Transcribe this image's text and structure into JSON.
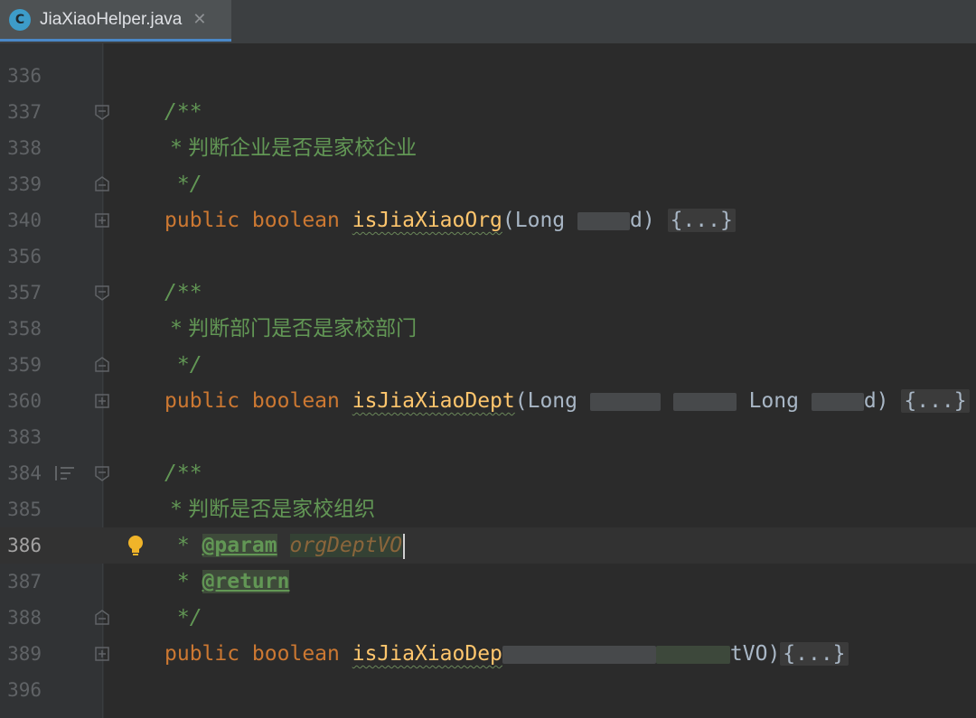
{
  "tab": {
    "icon_letter": "C",
    "filename": "JiaXiaoHelper.java",
    "close": "✕"
  },
  "lines": [
    {
      "n": "336"
    },
    {
      "n": "337",
      "comment": "/**"
    },
    {
      "n": "338",
      "comment": " * 判断企业是否是家校企业"
    },
    {
      "n": "339",
      "comment": " */"
    },
    {
      "n": "340",
      "kw": "public boolean",
      "fn": "isJiaXiaoOrg",
      "args_start": "(Long ",
      "args_end": "d)",
      "fold": "{...}"
    },
    {
      "n": "356"
    },
    {
      "n": "357",
      "comment": "/**"
    },
    {
      "n": "358",
      "comment": " * 判断部门是否是家校部门"
    },
    {
      "n": "359",
      "comment": " */"
    },
    {
      "n": "360",
      "kw": "public boolean",
      "fn": "isJiaXiaoDept",
      "args_start": "(Long ",
      "args_mid": "Long ",
      "args_end": "d)",
      "fold": "{...}"
    },
    {
      "n": "383"
    },
    {
      "n": "384",
      "comment": "/**"
    },
    {
      "n": "385",
      "comment": " * 判断是否是家校组织"
    },
    {
      "n": "386",
      "star": " * ",
      "tag": "@param",
      "pname": "orgDeptVO"
    },
    {
      "n": "387",
      "star": " * ",
      "tag": "@return"
    },
    {
      "n": "388",
      "comment": " */"
    },
    {
      "n": "389",
      "kw": "public boolean",
      "fn": "isJiaXiaoDep",
      "args_end": "tVO)",
      "fold": "{...}"
    },
    {
      "n": "396"
    }
  ],
  "colors": {
    "keyword": "#cc7832",
    "function": "#ffc66d",
    "doc": "#629755",
    "text": "#a9b7c6",
    "background": "#2b2b2b",
    "gutter": "#313335",
    "tab_accent": "#4a88c7"
  },
  "icons": [
    "java-class-icon",
    "close-icon",
    "fold-icon",
    "expand-icon",
    "lightbulb-icon",
    "structure-icon"
  ]
}
